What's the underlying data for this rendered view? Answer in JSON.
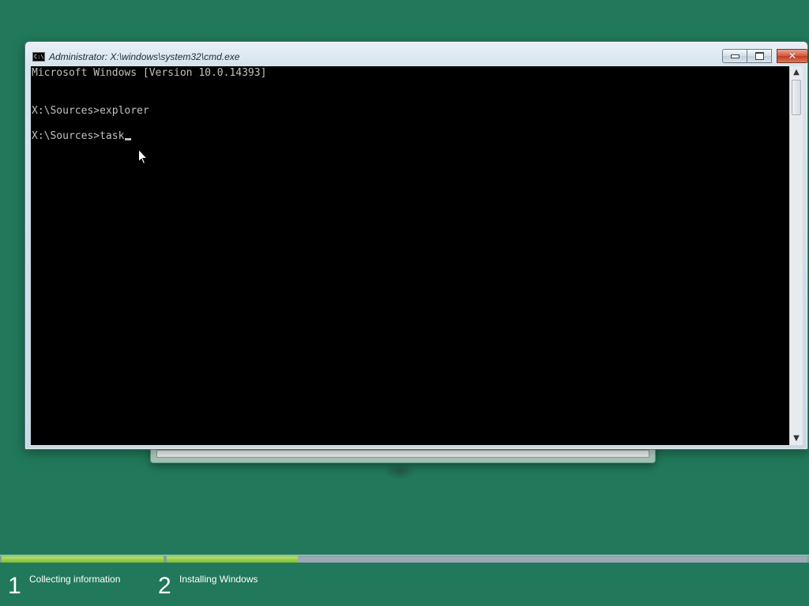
{
  "cmd_window": {
    "title": "Administrator: X:\\windows\\system32\\cmd.exe",
    "icon": "cmd-icon",
    "icon_text": "C:\\",
    "buttons": {
      "minimize": "minimize-icon",
      "maximize": "maximize-icon",
      "close": "close-icon"
    },
    "console_lines": [
      "Microsoft Windows [Version 10.0.14393]",
      "",
      "X:\\Sources>explorer",
      "",
      "X:\\Sources>task"
    ],
    "colors": {
      "background": "#000000",
      "text": "#c0c0c0"
    }
  },
  "setup_progress": {
    "steps": [
      {
        "number": "1",
        "label": "Collecting information",
        "progress": 1.0
      },
      {
        "number": "2",
        "label": "Installing Windows",
        "progress": 0.205
      }
    ],
    "colors": {
      "fill": "#8ccb3f",
      "track": "#9aa9b3"
    }
  },
  "desktop": {
    "background": "#21785a"
  }
}
